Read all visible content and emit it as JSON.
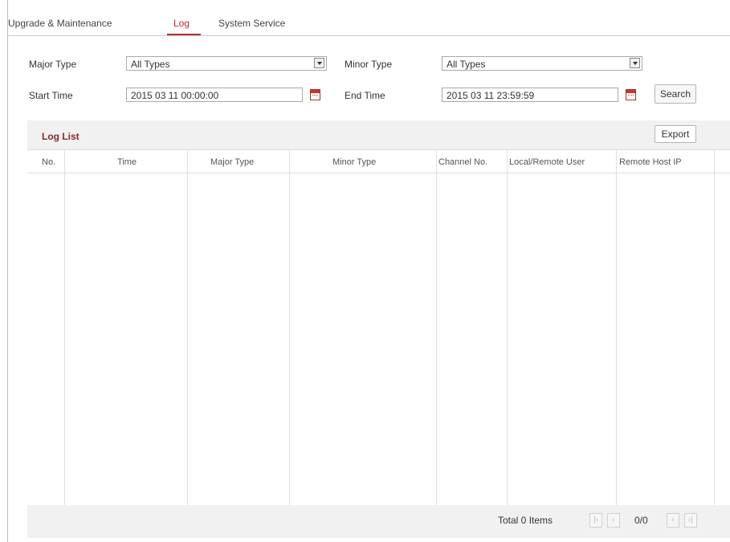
{
  "tabs": [
    {
      "label": "Upgrade & Maintenance"
    },
    {
      "label": "Log"
    },
    {
      "label": "System Service"
    }
  ],
  "form": {
    "major_type_label": "Major Type",
    "major_type_value": "All Types",
    "minor_type_label": "Minor Type",
    "minor_type_value": "All Types",
    "start_time_label": "Start Time",
    "start_time_value": "2015 03 11 00:00:00",
    "end_time_label": "End Time",
    "end_time_value": "2015 03 11 23:59:59",
    "search_label": "Search"
  },
  "log_list": {
    "title": "Log List",
    "export_label": "Export",
    "columns": [
      "No.",
      "Time",
      "Major Type",
      "Minor Type",
      "Channel No.",
      "Local/Remote User",
      "Remote Host IP"
    ],
    "rows": []
  },
  "pager": {
    "total_text": "Total 0 Items",
    "page_text": "0/0",
    "first_icon": "first-page-icon",
    "prev_icon": "prev-page-icon",
    "next_icon": "next-page-icon",
    "last_icon": "last-page-icon"
  },
  "colors": {
    "accent": "#b7282e",
    "panel_bg": "#f1f1f1"
  }
}
